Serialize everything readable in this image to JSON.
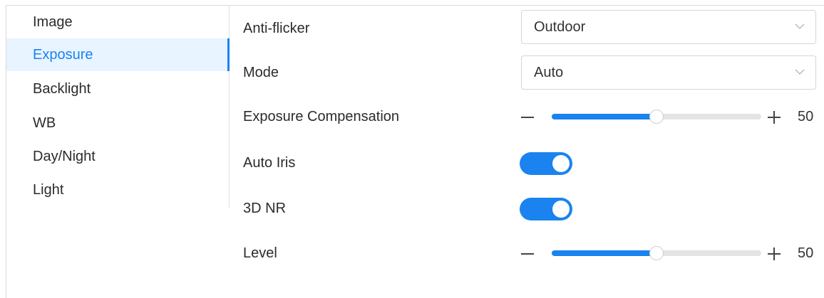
{
  "sidebar": {
    "items": [
      {
        "label": "Image"
      },
      {
        "label": "Exposure",
        "active": true
      },
      {
        "label": "Backlight"
      },
      {
        "label": "WB"
      },
      {
        "label": "Day/Night"
      },
      {
        "label": "Light"
      }
    ]
  },
  "settings": {
    "anti_flicker": {
      "label": "Anti-flicker",
      "value": "Outdoor"
    },
    "mode": {
      "label": "Mode",
      "value": "Auto"
    },
    "exposure_compensation": {
      "label": "Exposure Compensation",
      "value": "50",
      "level": 50,
      "max": 100
    },
    "auto_iris": {
      "label": "Auto Iris",
      "enabled": true
    },
    "nr_3d": {
      "label": "3D NR",
      "enabled": true
    },
    "level": {
      "label": "Level",
      "value": "50",
      "level": 50,
      "max": 100
    }
  },
  "colors": {
    "accent": "#1a83f0",
    "active_bg": "#e8f4ff"
  },
  "icons": {
    "select_arrow": "chevron-down-icon",
    "decrease": "minus-icon",
    "increase": "plus-icon"
  }
}
